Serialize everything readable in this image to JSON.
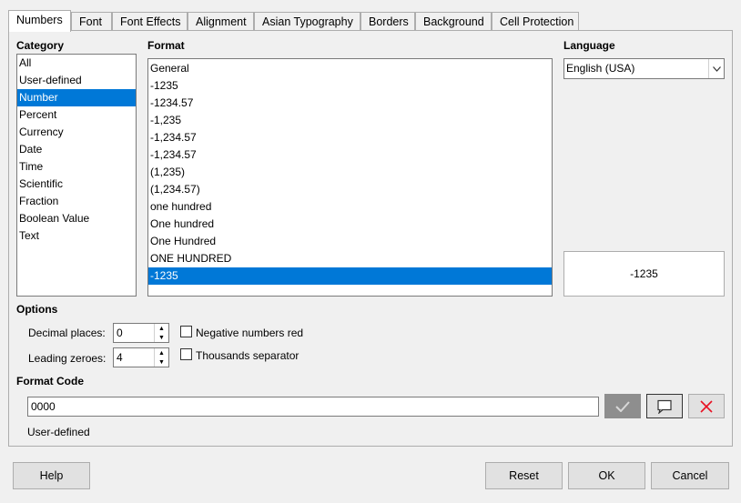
{
  "tabs": [
    "Numbers",
    "Font",
    "Font Effects",
    "Alignment",
    "Asian Typography",
    "Borders",
    "Background",
    "Cell Protection"
  ],
  "category": {
    "label": "Category",
    "items": [
      "All",
      "User-defined",
      "Number",
      "Percent",
      "Currency",
      "Date",
      "Time",
      "Scientific",
      "Fraction",
      "Boolean Value",
      "Text"
    ],
    "selected": "Number"
  },
  "format": {
    "label": "Format",
    "items": [
      "General",
      "-1235",
      "-1234.57",
      "-1,235",
      "-1,234.57",
      "-1,234.57",
      "(1,235)",
      "(1,234.57)",
      "one hundred",
      "One hundred",
      "One Hundred",
      "ONE HUNDRED",
      "-1235"
    ],
    "selected_index": 12
  },
  "language": {
    "label": "Language",
    "value": "English (USA)"
  },
  "preview": {
    "value": "-1235"
  },
  "options": {
    "label": "Options",
    "decimal_places_label": "Decimal places:",
    "decimal_places_value": "0",
    "leading_zeroes_label": "Leading zeroes:",
    "leading_zeroes_value": "4",
    "negative_red_label": "Negative numbers red",
    "negative_red_checked": false,
    "thousands_sep_label": "Thousands separator",
    "thousands_sep_checked": false
  },
  "format_code": {
    "label": "Format Code",
    "value": "0000",
    "status": "User-defined"
  },
  "buttons": {
    "help": "Help",
    "reset": "Reset",
    "ok": "OK",
    "cancel": "Cancel"
  },
  "colors": {
    "selection": "#0078d7",
    "accent_delete": "#e81123"
  }
}
